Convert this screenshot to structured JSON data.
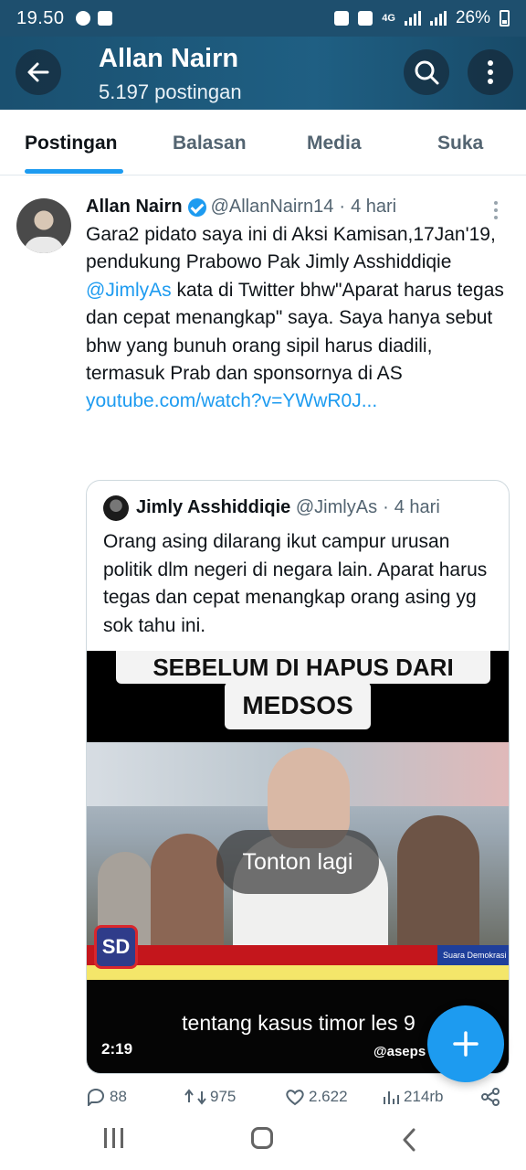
{
  "status_bar": {
    "time": "19.50",
    "network": "4G",
    "battery": "26%"
  },
  "header": {
    "title": "Allan Nairn",
    "subtitle": "5.197 postingan"
  },
  "tabs": [
    {
      "label": "Postingan",
      "active": true
    },
    {
      "label": "Balasan",
      "active": false
    },
    {
      "label": "Media",
      "active": false
    },
    {
      "label": "Suka",
      "active": false
    }
  ],
  "tweet": {
    "author_name": "Allan Nairn",
    "author_handle": "@AllanNairn14",
    "time": "4 hari",
    "text_part1": "Gara2 pidato saya ini di Aksi Kamisan,17Jan'19, pendukung Prabowo Pak Jimly Asshiddiqie",
    "mention": "@JimlyAs",
    "text_part2": " kata di Twitter bhw\"Aparat harus tegas dan cepat menangkap\" saya. Saya hanya sebut bhw yang bunuh orang sipil harus diadili, termasuk Prab dan sponsornya di AS",
    "link": "youtube.com/watch?v=YWwR0J...",
    "quote": {
      "author_name": "Jimly Asshiddiqie",
      "author_handle": "@JimlyAs",
      "time": "4 hari",
      "text": "Orang asing dilarang ikut campur urusan politik dlm negeri di negara lain. Aparat harus tegas dan cepat menangkap orang asing yg sok tahu ini.",
      "video": {
        "banner_line1": "SEBELUM DI HAPUS DARI",
        "banner_line2": "MEDSOS",
        "replay_label": "Tonton lagi",
        "caption": "tentang kasus timor les 9",
        "duration": "2:19",
        "watermark": "@aseps",
        "logo": "SD",
        "ticker_label": "Suara Demokrasi"
      }
    }
  },
  "actions": {
    "replies": "88",
    "reposts": "975",
    "likes": "2.622",
    "views": "214rb"
  },
  "colors": {
    "accent": "#1d9bf0",
    "header_bg": "#1e4f6e",
    "text": "#0f1419",
    "muted": "#536471"
  }
}
